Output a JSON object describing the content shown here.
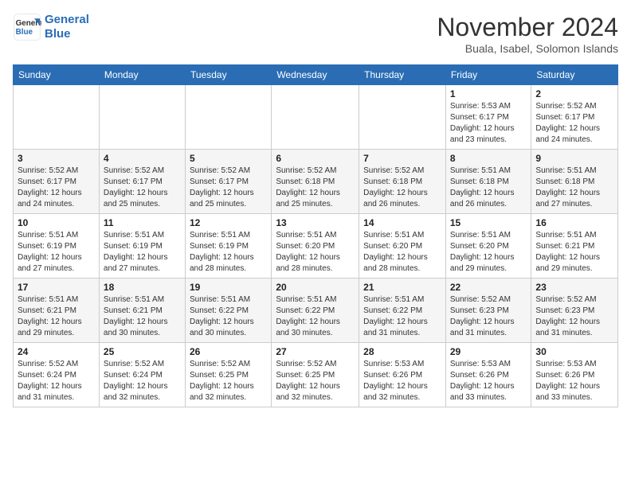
{
  "header": {
    "logo_line1": "General",
    "logo_line2": "Blue",
    "month": "November 2024",
    "location": "Buala, Isabel, Solomon Islands"
  },
  "weekdays": [
    "Sunday",
    "Monday",
    "Tuesday",
    "Wednesday",
    "Thursday",
    "Friday",
    "Saturday"
  ],
  "weeks": [
    [
      {
        "day": "",
        "info": ""
      },
      {
        "day": "",
        "info": ""
      },
      {
        "day": "",
        "info": ""
      },
      {
        "day": "",
        "info": ""
      },
      {
        "day": "",
        "info": ""
      },
      {
        "day": "1",
        "info": "Sunrise: 5:53 AM\nSunset: 6:17 PM\nDaylight: 12 hours\nand 23 minutes."
      },
      {
        "day": "2",
        "info": "Sunrise: 5:52 AM\nSunset: 6:17 PM\nDaylight: 12 hours\nand 24 minutes."
      }
    ],
    [
      {
        "day": "3",
        "info": "Sunrise: 5:52 AM\nSunset: 6:17 PM\nDaylight: 12 hours\nand 24 minutes."
      },
      {
        "day": "4",
        "info": "Sunrise: 5:52 AM\nSunset: 6:17 PM\nDaylight: 12 hours\nand 25 minutes."
      },
      {
        "day": "5",
        "info": "Sunrise: 5:52 AM\nSunset: 6:17 PM\nDaylight: 12 hours\nand 25 minutes."
      },
      {
        "day": "6",
        "info": "Sunrise: 5:52 AM\nSunset: 6:18 PM\nDaylight: 12 hours\nand 25 minutes."
      },
      {
        "day": "7",
        "info": "Sunrise: 5:52 AM\nSunset: 6:18 PM\nDaylight: 12 hours\nand 26 minutes."
      },
      {
        "day": "8",
        "info": "Sunrise: 5:51 AM\nSunset: 6:18 PM\nDaylight: 12 hours\nand 26 minutes."
      },
      {
        "day": "9",
        "info": "Sunrise: 5:51 AM\nSunset: 6:18 PM\nDaylight: 12 hours\nand 27 minutes."
      }
    ],
    [
      {
        "day": "10",
        "info": "Sunrise: 5:51 AM\nSunset: 6:19 PM\nDaylight: 12 hours\nand 27 minutes."
      },
      {
        "day": "11",
        "info": "Sunrise: 5:51 AM\nSunset: 6:19 PM\nDaylight: 12 hours\nand 27 minutes."
      },
      {
        "day": "12",
        "info": "Sunrise: 5:51 AM\nSunset: 6:19 PM\nDaylight: 12 hours\nand 28 minutes."
      },
      {
        "day": "13",
        "info": "Sunrise: 5:51 AM\nSunset: 6:20 PM\nDaylight: 12 hours\nand 28 minutes."
      },
      {
        "day": "14",
        "info": "Sunrise: 5:51 AM\nSunset: 6:20 PM\nDaylight: 12 hours\nand 28 minutes."
      },
      {
        "day": "15",
        "info": "Sunrise: 5:51 AM\nSunset: 6:20 PM\nDaylight: 12 hours\nand 29 minutes."
      },
      {
        "day": "16",
        "info": "Sunrise: 5:51 AM\nSunset: 6:21 PM\nDaylight: 12 hours\nand 29 minutes."
      }
    ],
    [
      {
        "day": "17",
        "info": "Sunrise: 5:51 AM\nSunset: 6:21 PM\nDaylight: 12 hours\nand 29 minutes."
      },
      {
        "day": "18",
        "info": "Sunrise: 5:51 AM\nSunset: 6:21 PM\nDaylight: 12 hours\nand 30 minutes."
      },
      {
        "day": "19",
        "info": "Sunrise: 5:51 AM\nSunset: 6:22 PM\nDaylight: 12 hours\nand 30 minutes."
      },
      {
        "day": "20",
        "info": "Sunrise: 5:51 AM\nSunset: 6:22 PM\nDaylight: 12 hours\nand 30 minutes."
      },
      {
        "day": "21",
        "info": "Sunrise: 5:51 AM\nSunset: 6:22 PM\nDaylight: 12 hours\nand 31 minutes."
      },
      {
        "day": "22",
        "info": "Sunrise: 5:52 AM\nSunset: 6:23 PM\nDaylight: 12 hours\nand 31 minutes."
      },
      {
        "day": "23",
        "info": "Sunrise: 5:52 AM\nSunset: 6:23 PM\nDaylight: 12 hours\nand 31 minutes."
      }
    ],
    [
      {
        "day": "24",
        "info": "Sunrise: 5:52 AM\nSunset: 6:24 PM\nDaylight: 12 hours\nand 31 minutes."
      },
      {
        "day": "25",
        "info": "Sunrise: 5:52 AM\nSunset: 6:24 PM\nDaylight: 12 hours\nand 32 minutes."
      },
      {
        "day": "26",
        "info": "Sunrise: 5:52 AM\nSunset: 6:25 PM\nDaylight: 12 hours\nand 32 minutes."
      },
      {
        "day": "27",
        "info": "Sunrise: 5:52 AM\nSunset: 6:25 PM\nDaylight: 12 hours\nand 32 minutes."
      },
      {
        "day": "28",
        "info": "Sunrise: 5:53 AM\nSunset: 6:26 PM\nDaylight: 12 hours\nand 32 minutes."
      },
      {
        "day": "29",
        "info": "Sunrise: 5:53 AM\nSunset: 6:26 PM\nDaylight: 12 hours\nand 33 minutes."
      },
      {
        "day": "30",
        "info": "Sunrise: 5:53 AM\nSunset: 6:26 PM\nDaylight: 12 hours\nand 33 minutes."
      }
    ]
  ]
}
